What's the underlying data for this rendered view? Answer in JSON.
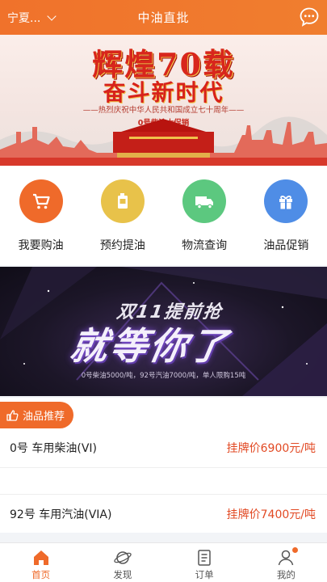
{
  "header": {
    "location": "宁夏...",
    "title": "中油直批",
    "message_icon": "chat-bubble-icon"
  },
  "banner_top": {
    "headline": "辉煌70载",
    "subheadline": "奋斗新时代",
    "caption": "——热烈庆祝中华人民共和国成立七十周年——",
    "promo": "0号柴油大促销"
  },
  "menu": {
    "items": [
      {
        "label": "我要购油",
        "icon": "shopping-cart-icon",
        "color": "#ef6a2a"
      },
      {
        "label": "预约提油",
        "icon": "fuel-can-icon",
        "color": "#e8c24a"
      },
      {
        "label": "物流查询",
        "icon": "truck-icon",
        "color": "#5cc87f"
      },
      {
        "label": "油品促销",
        "icon": "gift-icon",
        "color": "#4f8de6"
      }
    ]
  },
  "banner_promo": {
    "line1": "双11提前抢",
    "line2": "就等你了",
    "note": "0号柴油5000/吨，92号汽油7000/吨，单人限购15吨"
  },
  "section": {
    "tag_label": "油品推荐",
    "tag_icon": "thumbs-up-icon"
  },
  "products": [
    {
      "name": "0号  车用柴油(VI)",
      "price": "挂牌价6900元/吨"
    },
    {
      "name": "92号  车用汽油(VIA)",
      "price": "挂牌价7400元/吨"
    }
  ],
  "tabbar": {
    "items": [
      {
        "label": "首页",
        "icon": "home-icon",
        "active": true
      },
      {
        "label": "发现",
        "icon": "planet-icon",
        "active": false
      },
      {
        "label": "订单",
        "icon": "document-icon",
        "active": false
      },
      {
        "label": "我的",
        "icon": "person-icon",
        "active": false
      }
    ]
  },
  "colors": {
    "accent": "#ef6a2a",
    "price": "#e24a24"
  }
}
